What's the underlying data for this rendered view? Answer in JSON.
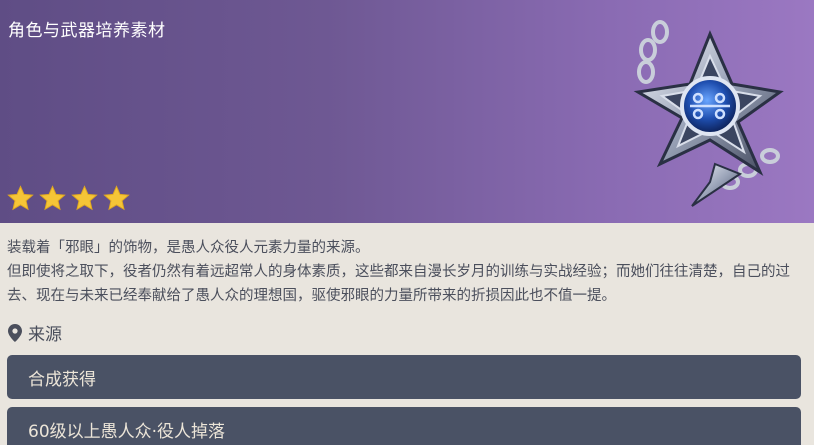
{
  "header": {
    "category": "角色与武器培养素材",
    "rarity": 4,
    "item_icon": "evil-eye-insignia-icon",
    "colors": {
      "gradient_start": "#5f4d85",
      "gradient_end": "#9b78c2",
      "star": "#f5c537"
    }
  },
  "description": {
    "lines": [
      "装载着「邪眼」的饰物，是愚人众役人元素力量的来源。",
      "但即使将之取下，役者仍然有着远超常人的身体素质，这些都来自漫长岁月的训练与实战经验；而她们往往清楚，自己的过去、现在与未来已经奉献给了愚人众的理想国，驱使邪眼的力量所带来的折损因此也不值一提。"
    ]
  },
  "source": {
    "heading": "来源",
    "items": [
      {
        "label": "合成获得"
      },
      {
        "label": "60级以上愚人众·役人掉落"
      }
    ]
  }
}
